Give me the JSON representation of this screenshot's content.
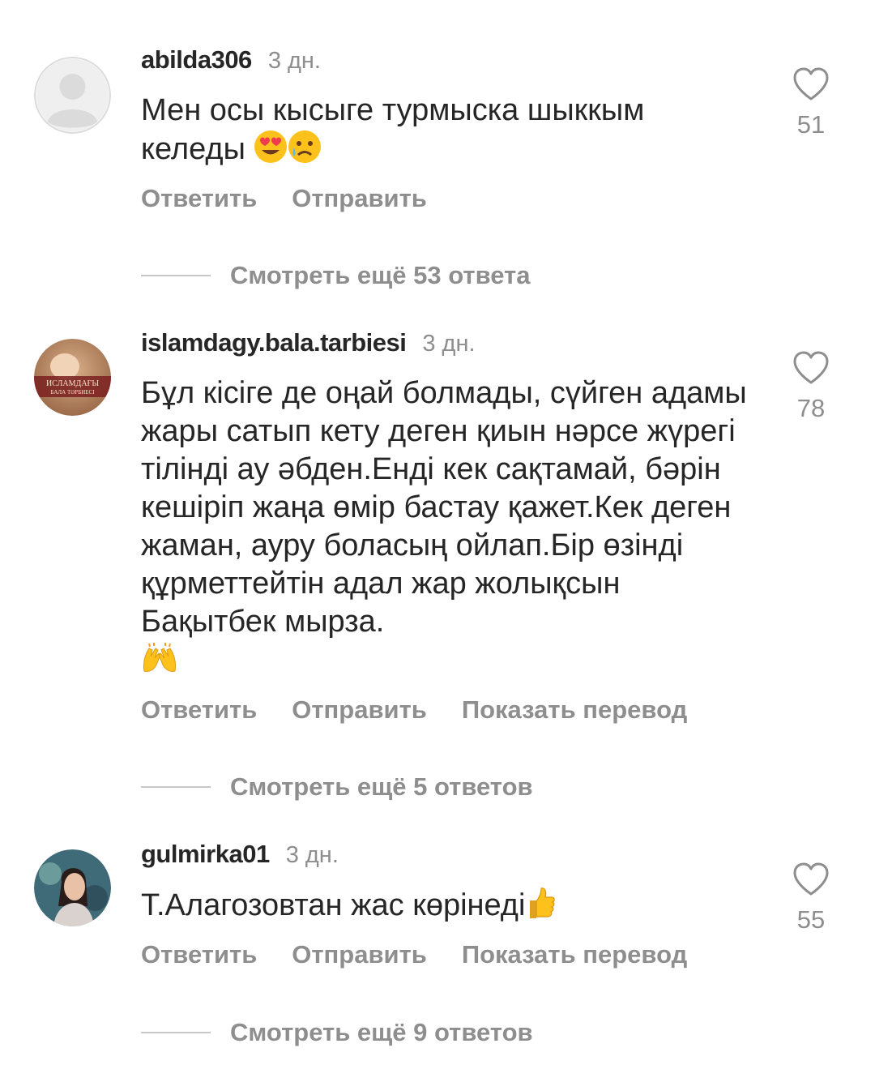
{
  "actions": {
    "reply": "Ответить",
    "send": "Отправить",
    "translate": "Показать перевод"
  },
  "comments": [
    {
      "username": "abilda306",
      "time": "3 дн.",
      "text": "Мен осы кысыге турмыска шыккым келеды",
      "emojis": [
        "heart-eyes",
        "crying-face"
      ],
      "likes": "51",
      "more_replies": "Смотреть ещё 53 ответа"
    },
    {
      "username": "islamdagy.bala.tarbiesi",
      "time": "3 дн.",
      "text": "Бұл кісіге де оңай болмады, сүйген адамы жары сатып кету деген қиын нәрсе жүрегі тілінді ау әбден.Енді кек сақтамай, бәрін кешіріп жаңа өмір бастау қажет.Кек деген жаман, ауру боласың ойлап.Бір өзінді құрметтейтін адал жар жолықсын Бақытбек мырза.",
      "emojis": [
        "raising-hands"
      ],
      "avatar_text": [
        "ИСЛАМДАҒЫ",
        "БАЛА ТӘРБИЕСІ"
      ],
      "likes": "78",
      "more_replies": "Смотреть ещё 5 ответов"
    },
    {
      "username": "gulmirka01",
      "time": "3 дн.",
      "text": "Т.Алагозовтан жас көрінеді",
      "emojis": [
        "thumbs-up"
      ],
      "likes": "55",
      "more_replies": "Смотреть ещё 9 ответов"
    }
  ]
}
